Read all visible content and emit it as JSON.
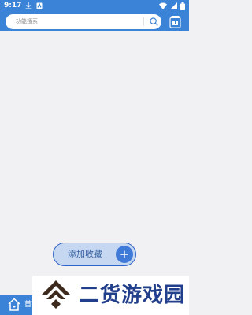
{
  "status_bar": {
    "time": "9:17",
    "icons": [
      "download-icon",
      "notification-icon",
      "wifi-icon",
      "signal-icon",
      "battery-icon"
    ]
  },
  "header": {
    "search": {
      "placeholder": "功能搜索",
      "icon": "search-icon"
    },
    "right_icon": "cards-icon"
  },
  "main": {
    "add_favorite": {
      "label": "添加收藏",
      "button_glyph": "+"
    }
  },
  "bottom_nav": {
    "home_label": "首",
    "home_icon": "home-icon"
  },
  "watermark": {
    "text": "二货游戏园"
  },
  "colors": {
    "primary": "#3a83d6",
    "background": "#f1f1f3",
    "pill_fill": "#c6d7f2",
    "pill_border": "#2f64c7",
    "plus_circle": "#3f7ad9",
    "watermark_text": "#223f8c"
  }
}
